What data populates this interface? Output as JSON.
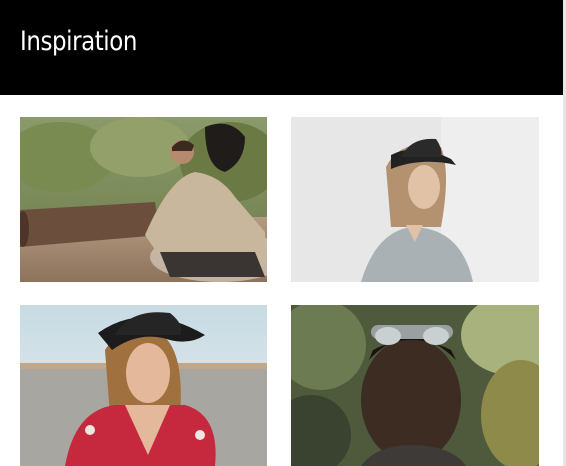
{
  "header": {
    "title": "Inspiration",
    "background": "#000000",
    "text_color": "#ffffff"
  },
  "gallery": {
    "items": [
      {
        "icon": "photo-man-hat-desert"
      },
      {
        "icon": "photo-woman-hat-grey"
      },
      {
        "icon": "photo-woman-hat-lake"
      },
      {
        "icon": "photo-man-sunglasses-forest"
      }
    ]
  }
}
